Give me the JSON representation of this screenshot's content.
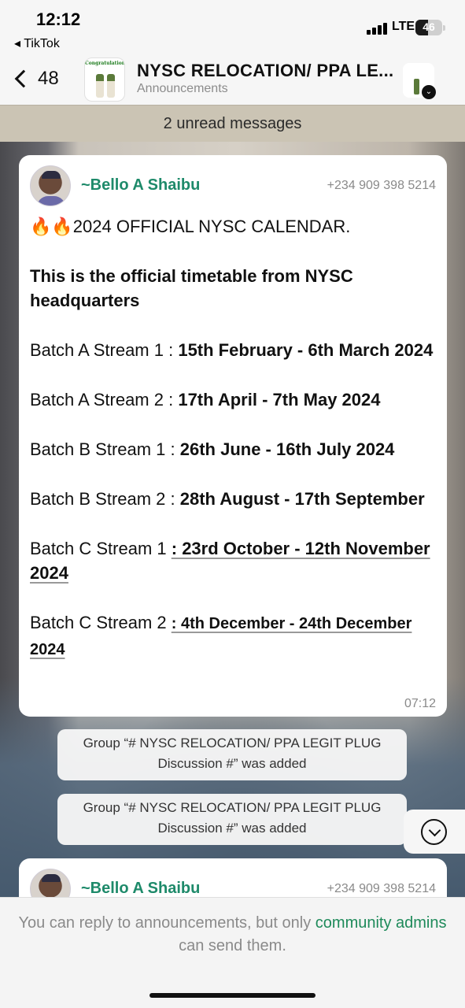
{
  "status": {
    "time": "12:12",
    "back_app": "◂ TikTok",
    "network": "LTE",
    "battery": "46"
  },
  "header": {
    "back_count": "48",
    "avatar_text": "Congratulations",
    "title": "NYSC RELOCATION/ PPA LE...",
    "subtitle": "Announcements"
  },
  "unread": "2 unread messages",
  "message": {
    "sender": "~Bello A Shaibu",
    "phone": "+234 909 398 5214",
    "fire": "🔥🔥",
    "headline": "2024 OFFICIAL NYSC CALENDAR.",
    "intro": "This is the official timetable from NYSC headquarters",
    "rows": [
      {
        "label": "Batch A Stream 1 : ",
        "value": "15th February  - 6th March 2024"
      },
      {
        "label": "Batch A Stream 2 : ",
        "value": "17th April - 7th May 2024"
      },
      {
        "label": "Batch B Stream 1 : ",
        "value": "26th June - 16th July 2024"
      },
      {
        "label": "Batch B Stream 2 : ",
        "value": "28th August - 17th September"
      },
      {
        "label": "Batch C Stream 1 ",
        "value": ": 23rd October - 12th November 2024"
      },
      {
        "label": "Batch C Stream 2 ",
        "value": ": 4th  December -   24th December 2024"
      }
    ],
    "time": "07:12"
  },
  "system_messages": [
    "Group “# NYSC RELOCATION/ PPA LEGIT PLUG Discussion #” was added",
    "Group “# NYSC RELOCATION/ PPA LEGIT PLUG Discussion #” was added"
  ],
  "message2": {
    "sender": "~Bello A Shaibu",
    "phone": "+234 909 398 5214"
  },
  "footer": {
    "text_before": "You can reply to announcements, but only ",
    "link": "community admins",
    "text_after": " can send them."
  }
}
